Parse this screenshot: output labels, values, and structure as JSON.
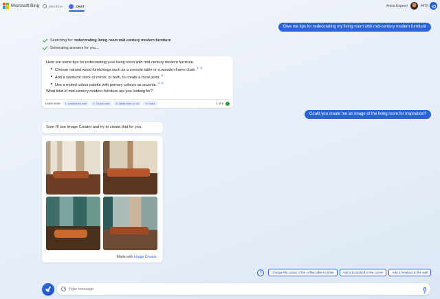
{
  "brand": {
    "name": "Microsoft Bing",
    "logo_colors": [
      "#f25022",
      "#7fba00",
      "#00a4ef",
      "#ffb900"
    ]
  },
  "nav": {
    "tabs": [
      {
        "label": "SEARCH",
        "icon": "search-icon",
        "active": false
      },
      {
        "label": "CHAT",
        "icon": "chat-bubble-icon",
        "active": true
      }
    ]
  },
  "user": {
    "name": "Anisa Koperzi",
    "points": "4475"
  },
  "conversation": {
    "user_message_1": "Give me tips for redecorating my living room with mid-century modern furniture",
    "status_search_prefix": "Searching for:",
    "status_search_query": "redecorating living room mid-century modern furniture",
    "status_generating": "Generating answers for you...",
    "answer": {
      "intro": "Here are some tips for redecorating your living room with mid-century modern furniture.",
      "tips": [
        {
          "text": "Choose natural wood furnishings such as a console table or a wooden frame chair.",
          "refs": [
            "1",
            "2"
          ]
        },
        {
          "text": "Add a sunburst clock or mirror, or both, to create a focal point.",
          "refs": [
            "3"
          ]
        },
        {
          "text": "Use a muted colour palette with primary colours as accents.",
          "refs": [
            "1",
            "2"
          ]
        }
      ],
      "question": "What kind of mid-century modern furniture are you looking for?",
      "learn_more_label": "Learn more:",
      "sources": [
        "1. realhomes.com",
        "2. 21oak.com",
        "3. idealhome.co.uk",
        "+2 more"
      ],
      "page_count": "1 of 6"
    },
    "user_message_2": "Could you create me an image of the living room for inspiration?",
    "bot_reply_2": "Sure I'll use Image Creator and try to create that for you.",
    "image_card": {
      "made_with_prefix": "Made with",
      "made_with_link": "Image Creator"
    }
  },
  "suggestions": [
    "Change the colour of the coffee table to white",
    "Add a bookshelf to the corner",
    "Add a fireplace to the wall"
  ],
  "composer": {
    "placeholder": "Type message"
  },
  "colors": {
    "accent": "#2b63d9",
    "success": "#3aa03a"
  }
}
